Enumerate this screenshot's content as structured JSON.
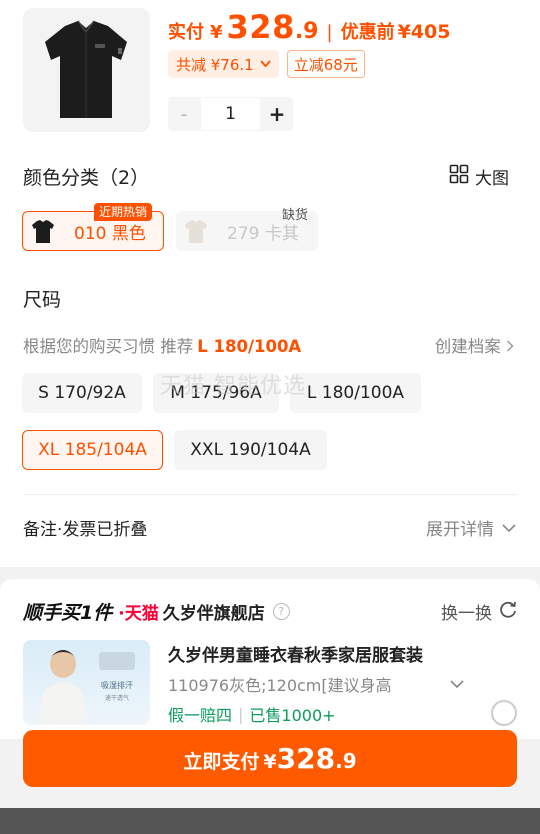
{
  "product": {
    "price_label": "实付",
    "currency": "¥",
    "price_int": "328",
    "price_dec": ".9",
    "separator": "|",
    "pre_label": "优惠前",
    "pre_value": "¥405",
    "total_discount": "共减 ¥76.1",
    "instant_discount": "立减68元",
    "quantity": "1",
    "minus": "-",
    "plus": "+"
  },
  "color_section": {
    "title": "颜色分类（2）",
    "big_view": "大图",
    "options": [
      {
        "label": "010 黑色",
        "badge": "近期热销",
        "selected": true
      },
      {
        "label": "279 卡其",
        "badge": "缺货",
        "selected": false
      }
    ]
  },
  "size_section": {
    "title": "尺码",
    "recommend_prefix": "根据您的购买习惯 推荐",
    "recommend_value": "L 180/100A",
    "profile_link": "创建档案",
    "sizes": [
      "S 170/92A",
      "M 175/96A",
      "L 180/100A",
      "XL 185/104A",
      "XXL 190/104A"
    ],
    "selected": "XL 185/104A",
    "watermark": "天猫 智能优选"
  },
  "remark": {
    "label": "备注·发票已折叠",
    "expand": "展开详情"
  },
  "addon": {
    "title": "顺手买1件",
    "platform": "·天猫",
    "shop": "久岁伴旗舰店",
    "swap": "换一换",
    "item_title": "久岁伴男童睡衣春秋季家居服套装",
    "item_spec": "110976灰色;120cm[建议身高",
    "tag_guarantee": "假一赔四",
    "tag_sold": "已售1000+",
    "img_tag_1": "吸湿排汗",
    "img_tag_2": "速干透气"
  },
  "pay": {
    "label": "立即支付",
    "currency": "¥",
    "price_int": "328",
    "price_dec": ".9"
  },
  "colors": {
    "accent": "#ff5000",
    "pay_button": "#ff5a00",
    "tmall_red": "#ff0036",
    "green_tag": "#0b9c5b"
  }
}
